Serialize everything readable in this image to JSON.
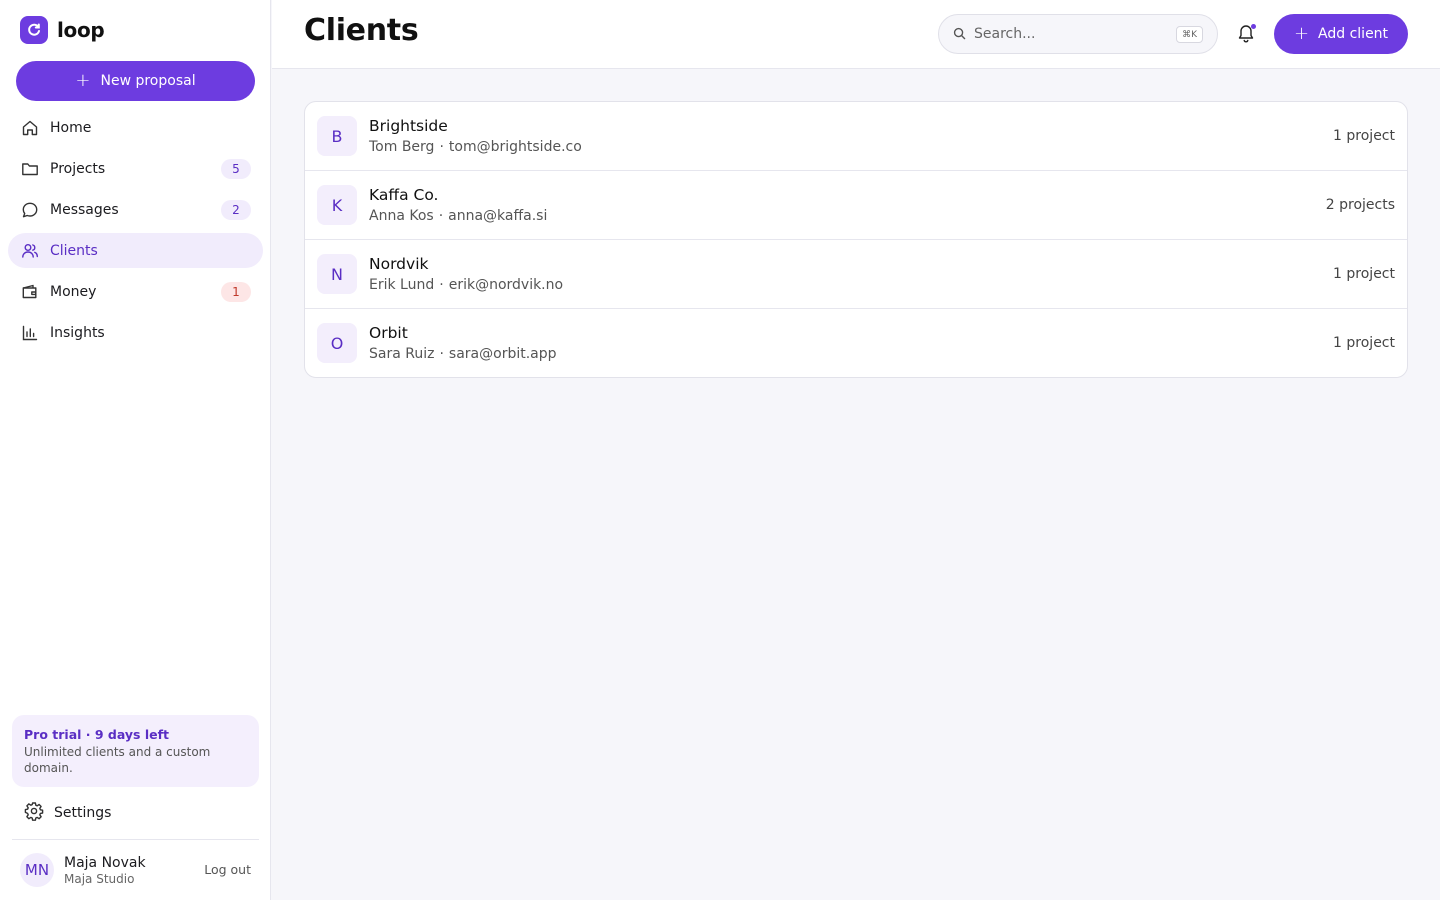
{
  "brand": {
    "name": "loop",
    "accent": "#6d3ce0"
  },
  "sidebar": {
    "new_button": "New proposal",
    "items": [
      {
        "label": "Home",
        "icon": "home-icon",
        "count": null,
        "active": false
      },
      {
        "label": "Projects",
        "icon": "folder-icon",
        "count": "5",
        "active": false
      },
      {
        "label": "Messages",
        "icon": "message-icon",
        "count": "2",
        "active": false
      },
      {
        "label": "Clients",
        "icon": "users-icon",
        "count": null,
        "active": true
      },
      {
        "label": "Money",
        "icon": "wallet-icon",
        "count": "1",
        "active": false
      },
      {
        "label": "Insights",
        "icon": "bar-chart-icon",
        "count": null,
        "active": false
      }
    ],
    "trial": {
      "title": "Pro trial · 9 days left",
      "text": "Unlimited clients and a custom domain."
    },
    "settings_label": "Settings",
    "user": {
      "initials": "MN",
      "name": "Maja Novak",
      "org": "Maja Studio",
      "logout": "Log out"
    }
  },
  "header": {
    "title": "Clients",
    "search_placeholder": "Search...",
    "search_shortcut": "⌘K",
    "add_button": "Add client"
  },
  "clients": [
    {
      "initial": "B",
      "name": "Brightside",
      "contact": "Tom Berg",
      "email": "tom@brightside.co",
      "projects": "1 project"
    },
    {
      "initial": "K",
      "name": "Kaffa Co.",
      "contact": "Anna Kos",
      "email": "anna@kaffa.si",
      "projects": "2 projects"
    },
    {
      "initial": "N",
      "name": "Nordvik",
      "contact": "Erik Lund",
      "email": "erik@nordvik.no",
      "projects": "1 project"
    },
    {
      "initial": "O",
      "name": "Orbit",
      "contact": "Sara Ruiz",
      "email": "sara@orbit.app",
      "projects": "1 project"
    }
  ]
}
